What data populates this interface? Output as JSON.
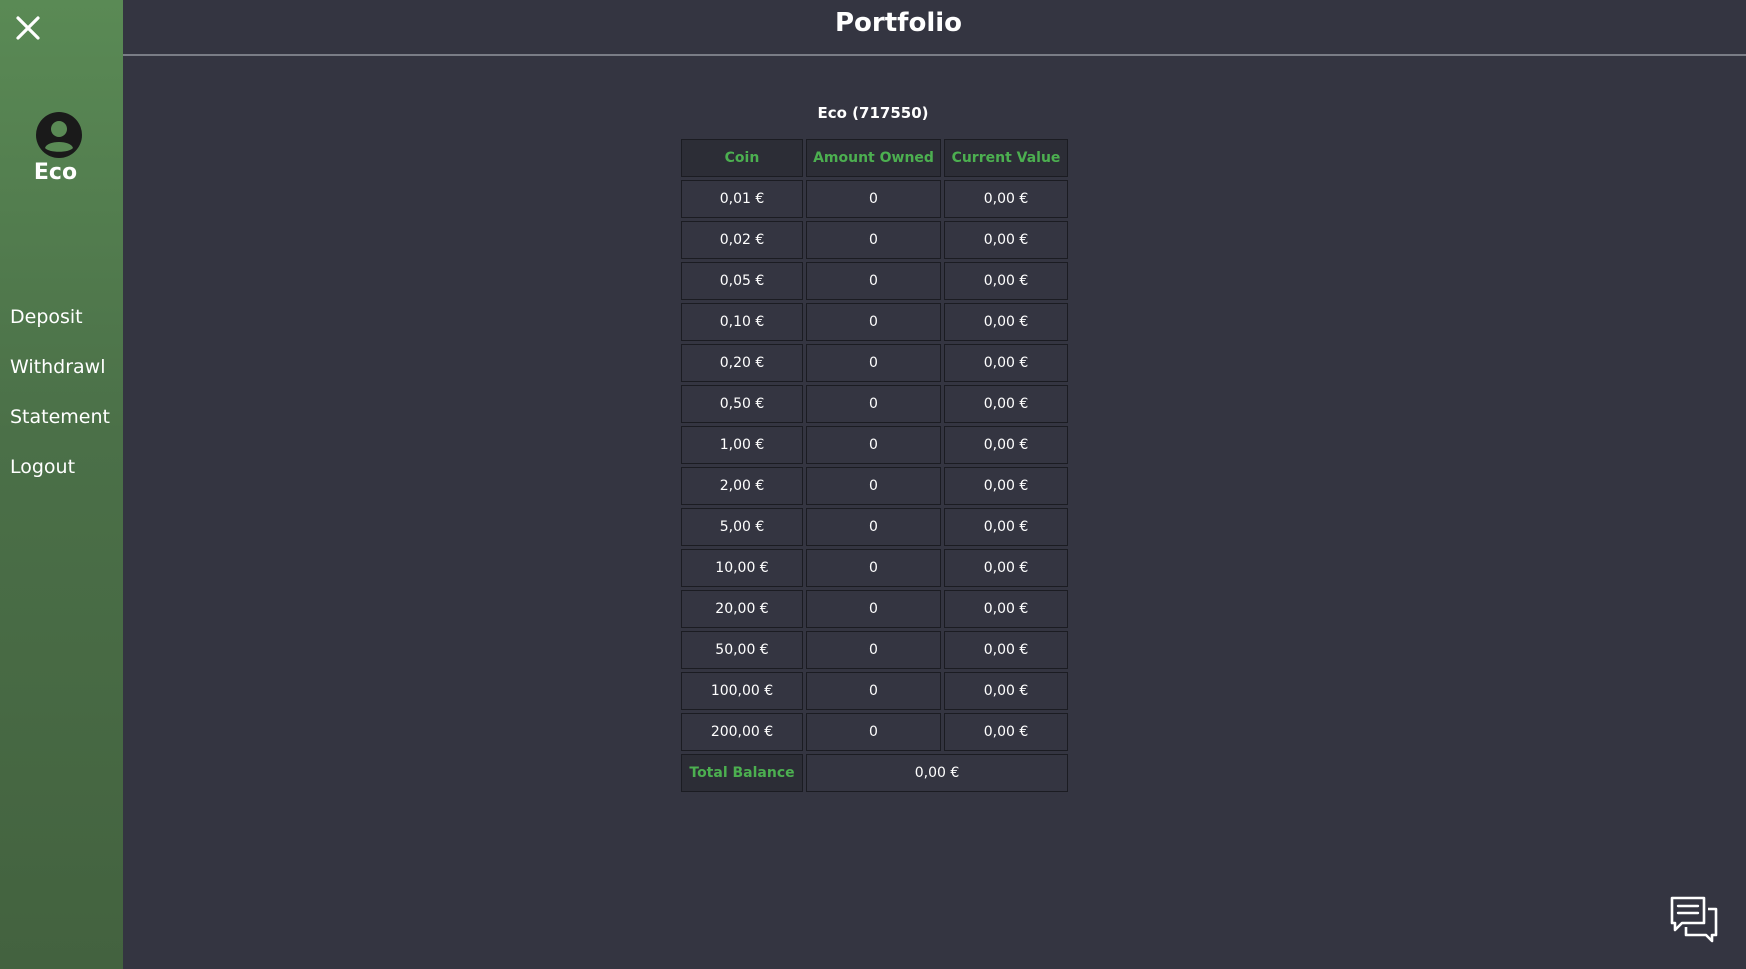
{
  "header": {
    "title": "Portfolio"
  },
  "sidebar": {
    "username": "Eco",
    "nav": [
      {
        "label": "Deposit"
      },
      {
        "label": "Withdrawl"
      },
      {
        "label": "Statement"
      },
      {
        "label": "Logout"
      }
    ]
  },
  "account": {
    "title": "Eco (717550)"
  },
  "table": {
    "headers": [
      "Coin",
      "Amount Owned",
      "Current Value"
    ],
    "rows": [
      {
        "coin": "0,01 €",
        "amount": "0",
        "value": "0,00 €"
      },
      {
        "coin": "0,02 €",
        "amount": "0",
        "value": "0,00 €"
      },
      {
        "coin": "0,05 €",
        "amount": "0",
        "value": "0,00 €"
      },
      {
        "coin": "0,10 €",
        "amount": "0",
        "value": "0,00 €"
      },
      {
        "coin": "0,20 €",
        "amount": "0",
        "value": "0,00 €"
      },
      {
        "coin": "0,50 €",
        "amount": "0",
        "value": "0,00 €"
      },
      {
        "coin": "1,00 €",
        "amount": "0",
        "value": "0,00 €"
      },
      {
        "coin": "2,00 €",
        "amount": "0",
        "value": "0,00 €"
      },
      {
        "coin": "5,00 €",
        "amount": "0",
        "value": "0,00 €"
      },
      {
        "coin": "10,00 €",
        "amount": "0",
        "value": "0,00 €"
      },
      {
        "coin": "20,00 €",
        "amount": "0",
        "value": "0,00 €"
      },
      {
        "coin": "50,00 €",
        "amount": "0",
        "value": "0,00 €"
      },
      {
        "coin": "100,00 €",
        "amount": "0",
        "value": "0,00 €"
      },
      {
        "coin": "200,00 €",
        "amount": "0",
        "value": "0,00 €"
      }
    ],
    "total_label": "Total Balance",
    "total_value": "0,00 €"
  },
  "colors": {
    "accent": "#4caf50",
    "background": "#343541",
    "sidebar": "#4b7048"
  },
  "icons": {
    "close": "close-icon",
    "avatar": "user-circle-icon",
    "chat": "chat-bubbles-icon"
  }
}
